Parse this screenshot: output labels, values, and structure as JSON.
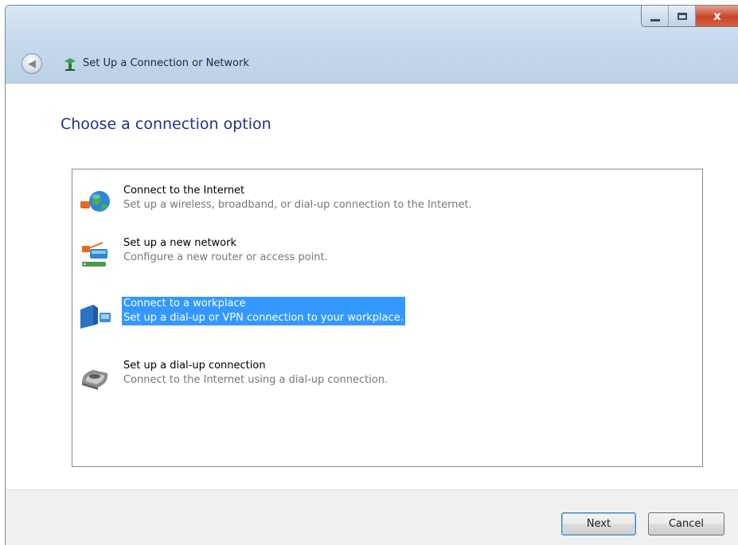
{
  "window": {
    "title": "Set Up a Connection or Network",
    "close_glyph": "x"
  },
  "main": {
    "heading": "Choose a connection option",
    "options": [
      {
        "title": "Connect to the Internet",
        "description": "Set up a wireless, broadband, or dial-up connection to the Internet.",
        "icon": "globe-network-icon",
        "selected": false
      },
      {
        "title": "Set up a new network",
        "description": "Configure a new router or access point.",
        "icon": "router-icon",
        "selected": false
      },
      {
        "title": "Connect to a workplace",
        "description": "Set up a dial-up or VPN connection to your workplace.",
        "icon": "workplace-vpn-icon",
        "selected": true
      },
      {
        "title": "Set up a dial-up connection",
        "description": "Connect to the Internet using a dial-up connection.",
        "icon": "dialup-modem-icon",
        "selected": false
      }
    ]
  },
  "footer": {
    "next_label": "Next",
    "cancel_label": "Cancel"
  },
  "colors": {
    "heading": "#1e3287",
    "selection": "#3399ff",
    "close_button": "#c6452a"
  }
}
